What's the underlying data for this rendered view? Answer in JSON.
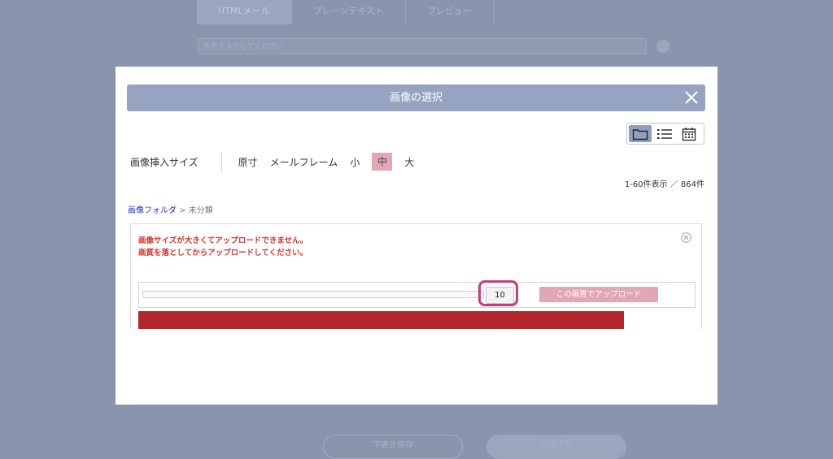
{
  "background": {
    "tabs": [
      "HTMLメール",
      "プレーンテキスト",
      "プレビュー"
    ],
    "input_placeholder": "件名を入力してください",
    "btn_left": "下書き保存",
    "btn_right": "配信予約"
  },
  "modal": {
    "title": "画像の選択",
    "size_label": "画像挿入サイズ",
    "size_options": [
      "原寸",
      "メールフレーム",
      "小",
      "中",
      "大"
    ],
    "selected_size": "中",
    "count_text": "1-60件表示 ／ 864件",
    "breadcrumb": {
      "folder": "画像フォルダ",
      "separator": " > ",
      "current": "未分類"
    },
    "error": {
      "line1": "画像サイズが大きくてアップロードできません。",
      "line2": "画質を落としてからアップロードしてください。"
    },
    "quality_value": "10",
    "upload_button": "この画質でアップロード"
  },
  "icons": {
    "close": "close-icon",
    "folder": "folder-icon",
    "list": "list-icon",
    "calendar": "calendar-icon"
  },
  "colors": {
    "header": "#96a4c1",
    "selected_size": "#e3a7b6",
    "error_text": "#d9342b",
    "upload_button": "#e1a7b4",
    "highlight": "#c83a7b",
    "red_bar": "#b3262b"
  }
}
